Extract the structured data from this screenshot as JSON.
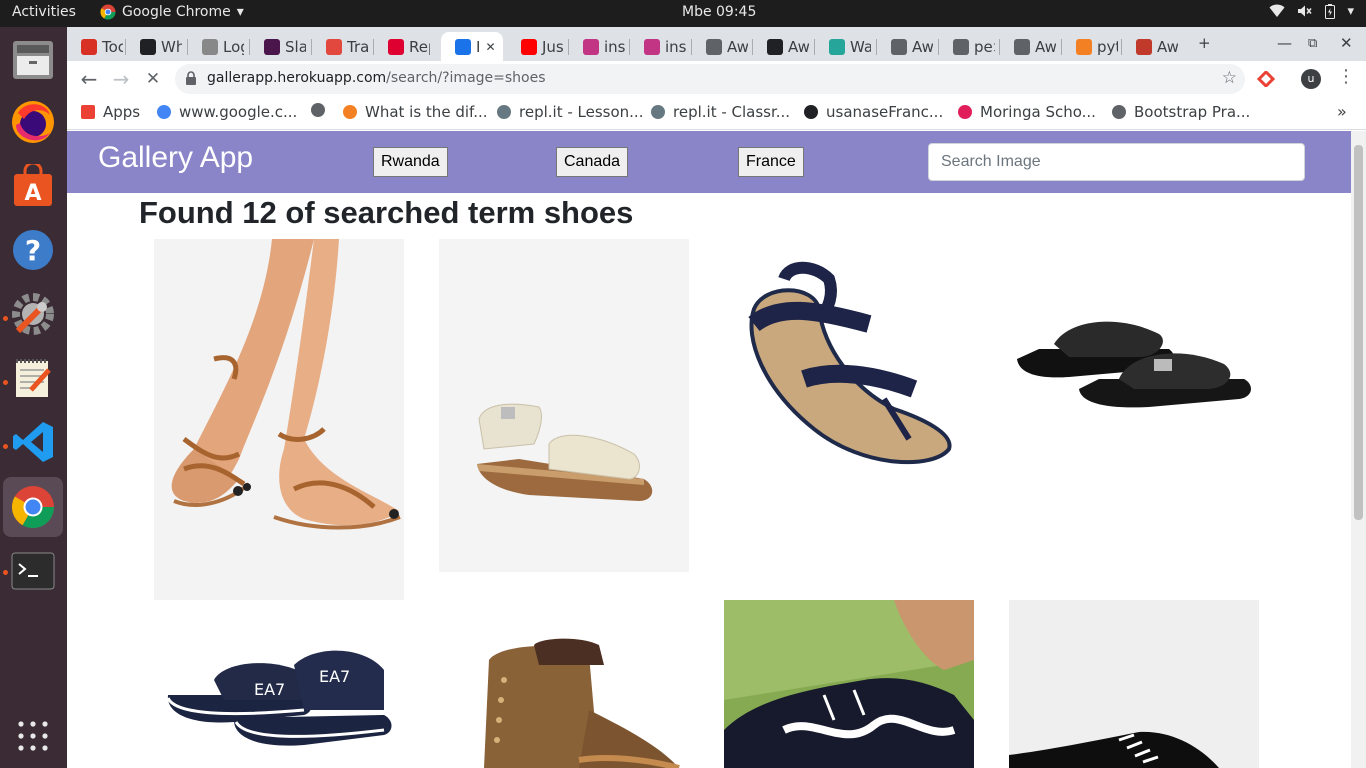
{
  "system": {
    "activities_label": "Activities",
    "app_name": "Google Chrome",
    "clock": "Mbe 09:45"
  },
  "tabs": [
    {
      "label": "Toc",
      "icon": "gmail-icon",
      "color": "#d93025"
    },
    {
      "label": "Wh",
      "icon": "github-icon",
      "color": "#202124"
    },
    {
      "label": "Log",
      "icon": "tree-icon",
      "color": "#888888"
    },
    {
      "label": "Sla",
      "icon": "slack-icon",
      "color": "#4a154b"
    },
    {
      "label": "Tra",
      "icon": "trello-icon",
      "color": "#e2483d"
    },
    {
      "label": "Rep",
      "icon": "angular-icon",
      "color": "#dd0031"
    },
    {
      "label": "I",
      "icon": "loading-icon",
      "color": "#1a73e8"
    },
    {
      "label": "Jus",
      "icon": "youtube-icon",
      "color": "#ff0000"
    },
    {
      "label": "ins",
      "icon": "instagram-icon",
      "color": "#c13584"
    },
    {
      "label": "ins",
      "icon": "instagram-icon",
      "color": "#c13584"
    },
    {
      "label": "Aw",
      "icon": "globe-icon",
      "color": "#5f6368"
    },
    {
      "label": "Aw",
      "icon": "github-icon",
      "color": "#202124"
    },
    {
      "label": "Wa",
      "icon": "docs-icon",
      "color": "#26a69a"
    },
    {
      "label": "Aw",
      "icon": "globe-icon",
      "color": "#5f6368"
    },
    {
      "label": "pe>",
      "icon": "globe-icon",
      "color": "#5f6368"
    },
    {
      "label": "Aw",
      "icon": "globe-icon",
      "color": "#5f6368"
    },
    {
      "label": "pyt",
      "icon": "stackoverflow-icon",
      "color": "#f48024"
    },
    {
      "label": "Aw",
      "icon": "star-icon",
      "color": "#c0392b"
    }
  ],
  "toolbar": {
    "url_host": "gallerapp.herokuapp.com",
    "url_path": "/search/?image=shoes",
    "profile_initial": "u"
  },
  "bookmarks": [
    {
      "label": "Apps",
      "icon": "apps-grid-icon",
      "color": "#ea4335"
    },
    {
      "label": "www.google.c...",
      "icon": "google-icon",
      "color": "#4285f4"
    },
    {
      "label": "",
      "icon": "globe-icon",
      "color": "#5f6368"
    },
    {
      "label": "What is the dif...",
      "icon": "stackoverflow-icon",
      "color": "#f48024"
    },
    {
      "label": "repl.it - Lesson...",
      "icon": "replit-icon",
      "color": "#667881"
    },
    {
      "label": "repl.it - Classr...",
      "icon": "replit-icon",
      "color": "#667881"
    },
    {
      "label": "usanaseFranc...",
      "icon": "github-icon",
      "color": "#202124"
    },
    {
      "label": "Moringa Scho...",
      "icon": "slack-icon",
      "color": "#e01e5a"
    },
    {
      "label": "Bootstrap Pra...",
      "icon": "globe-icon",
      "color": "#5f6368"
    }
  ],
  "app": {
    "brand": "Gallery App",
    "nav_color": "#8a84c8",
    "countries": [
      "Rwanda",
      "Canada",
      "France"
    ],
    "search_placeholder": "Search Image",
    "result_title": "Found 12 of searched term shoes"
  },
  "images": [
    {
      "alt": "legs wearing brown strappy sandals"
    },
    {
      "alt": "cream and cork kids sandal"
    },
    {
      "alt": "navy and tan sport sandal"
    },
    {
      "alt": "black leather slide sandals"
    },
    {
      "alt": "navy EA7 slide sandals"
    },
    {
      "alt": "brown lace-up boot"
    },
    {
      "alt": "black and white running sneaker on foot"
    },
    {
      "alt": "black and white sneaker"
    }
  ]
}
